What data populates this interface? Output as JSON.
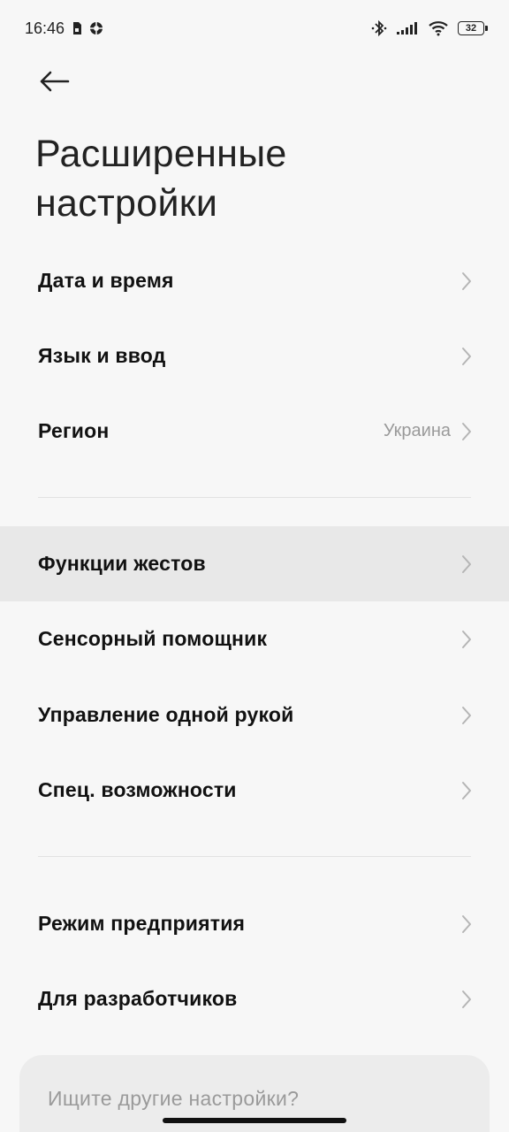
{
  "status_bar": {
    "time": "16:46",
    "icons_left": [
      "sim-icon",
      "vpn-icon"
    ],
    "icons_right": [
      "bluetooth-icon",
      "signal-icon",
      "wifi-icon"
    ],
    "battery": "32"
  },
  "header": {
    "back_icon": "arrow-left-icon",
    "title": "Расширенные настройки"
  },
  "sections": [
    {
      "items": [
        {
          "label": "Дата и время",
          "value": ""
        },
        {
          "label": "Язык и ввод",
          "value": ""
        },
        {
          "label": "Регион",
          "value": "Украина"
        }
      ]
    },
    {
      "items": [
        {
          "label": "Функции жестов",
          "value": "",
          "highlighted": true
        },
        {
          "label": "Сенсорный помощник",
          "value": ""
        },
        {
          "label": "Управление одной рукой",
          "value": ""
        },
        {
          "label": "Спец. возможности",
          "value": ""
        }
      ]
    },
    {
      "items": [
        {
          "label": "Режим предприятия",
          "value": ""
        },
        {
          "label": "Для разработчиков",
          "value": ""
        }
      ]
    }
  ],
  "search_card": {
    "text": "Ищите другие настройки?"
  },
  "colors": {
    "background": "#f7f7f7",
    "highlight": "#e8e8e8",
    "value_text": "#9a9a9a"
  }
}
